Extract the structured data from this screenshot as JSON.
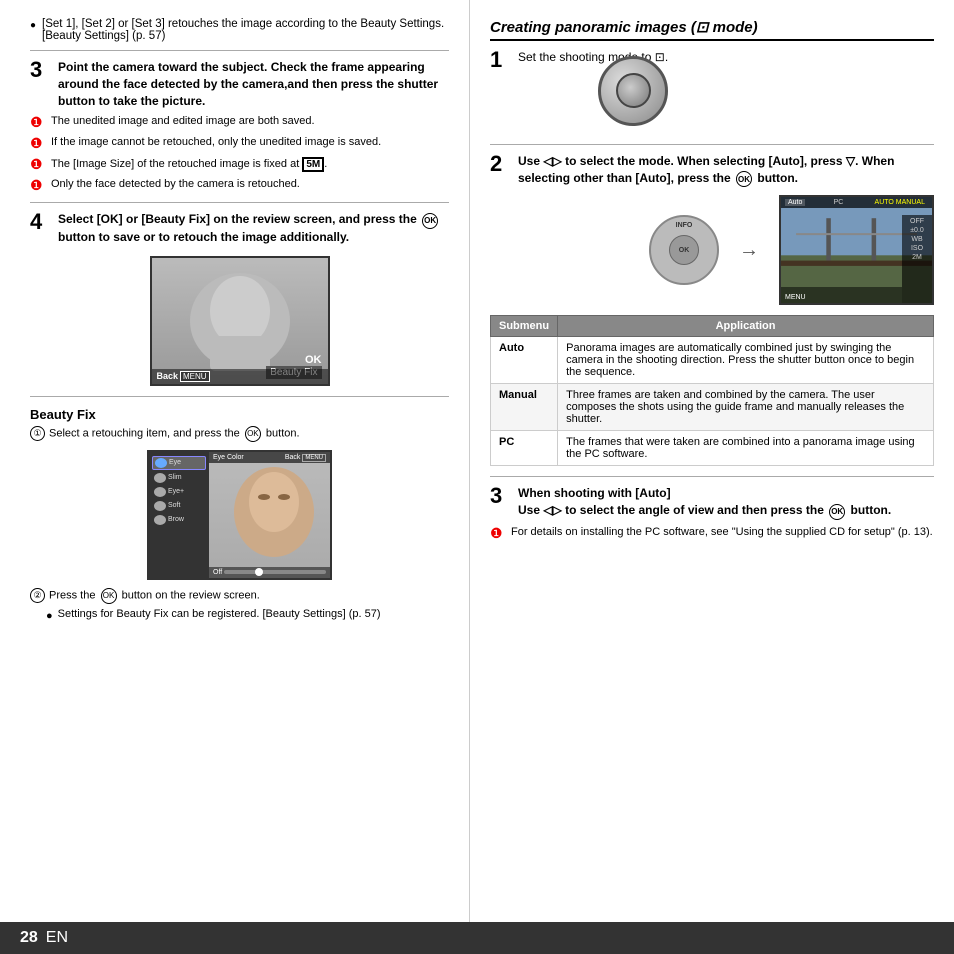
{
  "page": {
    "number": "28",
    "en_label": "EN"
  },
  "left_col": {
    "intro_bullet": "[Set 1], [Set 2] or [Set 3] retouches the image according to the Beauty Settings. [Beauty Settings] (p. 57)",
    "step3": {
      "num": "3",
      "text": "Point the camera toward the subject. Check the frame appearing around the face detected by the camera,and then press the shutter button to take the picture."
    },
    "warnings": [
      "The unedited image and edited image are both saved.",
      "If the image cannot be retouched, only the unedited image is saved.",
      "The [Image Size] of the retouched image is fixed at [5M].",
      "Only the face detected by the camera is retouched."
    ],
    "step4": {
      "num": "4",
      "text": "Select [OK] or [Beauty Fix] on the review screen, and press the",
      "ok_symbol": "OK",
      "text2": "button to save or to retouch the image additionally."
    },
    "camera_screen": {
      "ok_label": "OK",
      "beauty_fix_label": "Beauty Fix",
      "back_label": "Back",
      "menu_label": "MENU"
    },
    "beauty_fix_section": {
      "title": "Beauty Fix",
      "step1_text": "Select a retouching item, and press the",
      "ok_symbol": "OK",
      "step1_text2": "button.",
      "screen": {
        "top_left_label": "Eye Color",
        "top_right_label": "Back",
        "menu_badge": "MENU",
        "off_label": "Off",
        "icons": [
          "eye-color",
          "slim-face",
          "eye-enhance",
          "soft-skin",
          "eyebrow"
        ]
      },
      "step2_prefix": "Press the",
      "step2_ok": "OK",
      "step2_text": "button on the review screen.",
      "sub_bullets": [
        "Settings for Beauty Fix can be registered. [Beauty Settings] (p. 57)"
      ]
    }
  },
  "right_col": {
    "section_title": "Creating panoramic images (⊡ mode)",
    "step1": {
      "num": "1",
      "text": "Set the shooting mode to ⊡."
    },
    "step2": {
      "num": "2",
      "text": "Use ◁▷ to select the mode. When selecting [Auto], press ▽. When selecting other than [Auto], press the",
      "ok_symbol": "OK",
      "text2": "button."
    },
    "pano_screen": {
      "tabs": [
        "Auto",
        "PC",
        "AUTO",
        "MANUAL"
      ],
      "active_tab": "Auto",
      "highlight_tab": "AUTO",
      "right_items": [
        "OFF",
        "±0.0",
        "WB",
        "ISO",
        "2M"
      ],
      "menu_label": "MENU"
    },
    "table": {
      "headers": [
        "Submenu",
        "Application"
      ],
      "rows": [
        {
          "submenu": "Auto",
          "application": "Panorama images are automatically combined just by swinging the camera in the shooting direction. Press the shutter button once to begin the sequence."
        },
        {
          "submenu": "Manual",
          "application": "Three frames are taken and combined by the camera. The user composes the shots using the guide frame and manually releases the shutter."
        },
        {
          "submenu": "PC",
          "application": "The frames that were taken are combined into a panorama image using the PC software."
        }
      ]
    },
    "step3": {
      "num": "3",
      "text_bold": "When shooting with [Auto]",
      "text": "Use ◁▷ to select the angle of view and then press the",
      "ok_symbol": "OK",
      "text2": "button."
    },
    "warning": "For details on installing the PC software, see \"Using the supplied CD for setup\" (p. 13)."
  }
}
